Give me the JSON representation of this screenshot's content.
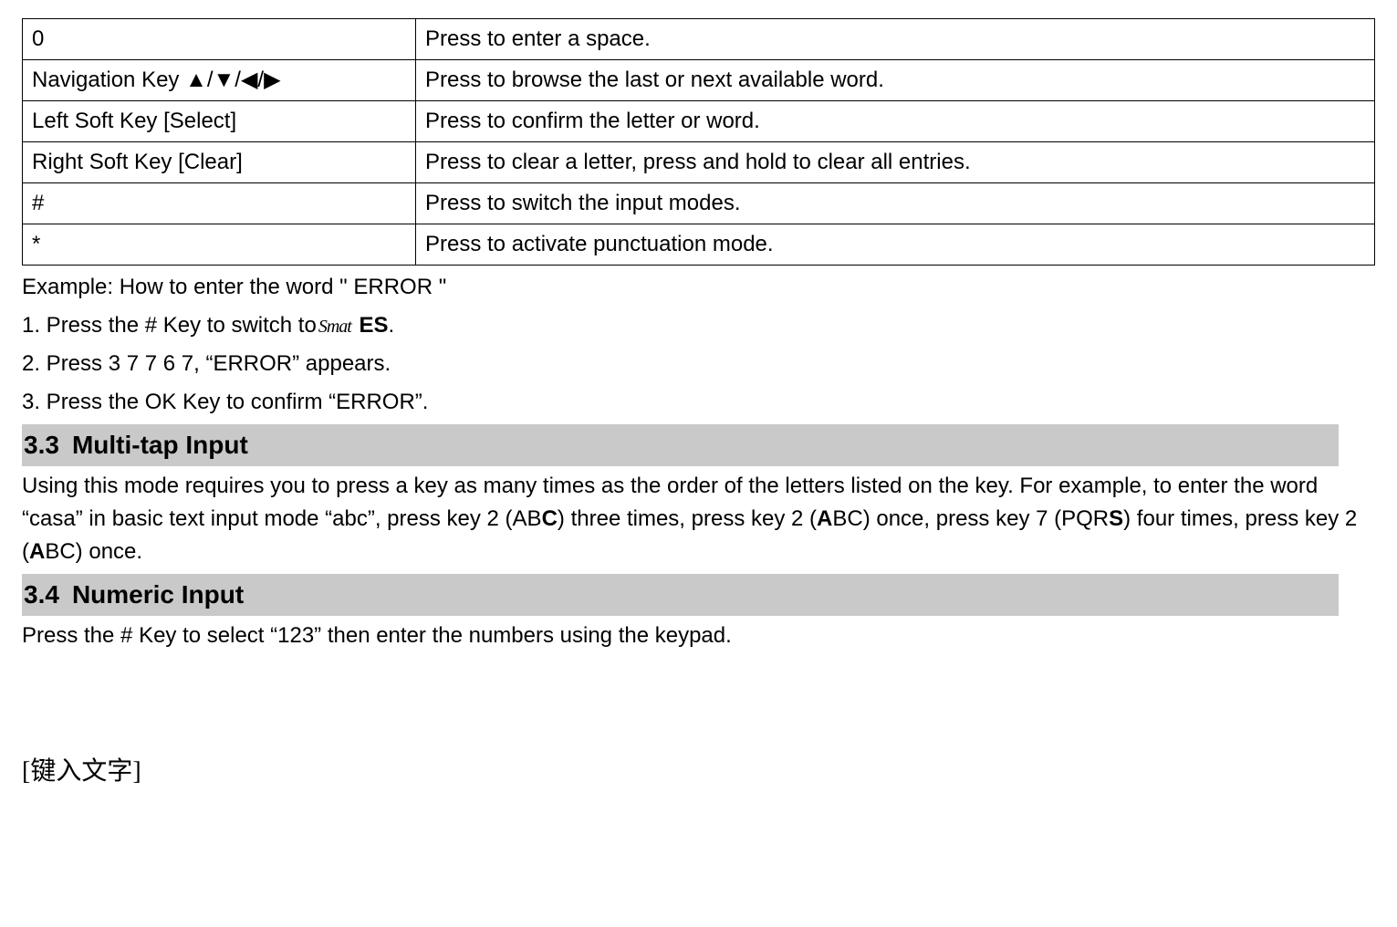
{
  "table": {
    "rows": [
      {
        "key": "0",
        "desc": "Press to enter a space."
      },
      {
        "key": "Navigation Key ▲/▼/◀/▶",
        "desc": "Press to browse the last or next available word."
      },
      {
        "key": "Left Soft Key [Select]",
        "desc": "Press to confirm the letter or word."
      },
      {
        "key": "Right Soft Key [Clear]",
        "desc": "Press to clear a letter, press and hold to clear all entries."
      },
      {
        "key": "#",
        "desc": "Press to switch the input modes."
      },
      {
        "key": "*",
        "desc": "Press to activate punctuation mode."
      }
    ]
  },
  "example": {
    "intro": "Example: How to enter the word \" ERROR \"",
    "step1_a": "1. Press the # Key to switch to",
    "step1_icon": "Smat",
    "step1_b": " ES",
    "step1_c": ".",
    "step2": "2. Press 3 7 7 6 7, “ERROR” appears.",
    "step3": "3. Press the OK Key to confirm “ERROR”."
  },
  "section33": {
    "num": "3.3",
    "title": "Multi-tap Input",
    "body_prefix": "Using this mode requires you to press a key as many times as the order of the letters listed on the key. For example, to enter the word “casa” in basic text input mode “abc”, press key 2 (AB",
    "b1": "C",
    "body_mid1": ") three times, press key 2 (",
    "b2": "A",
    "body_mid2": "BC) once, press key 7 (PQR",
    "b3": "S",
    "body_mid3": ") four times, press key 2 (",
    "b4": "A",
    "body_end": "BC) once."
  },
  "section34": {
    "num": "3.4",
    "title": "Numeric Input",
    "body": "Press the # Key to select “123” then enter the numbers using the keypad."
  },
  "footer": "[键入文字]"
}
